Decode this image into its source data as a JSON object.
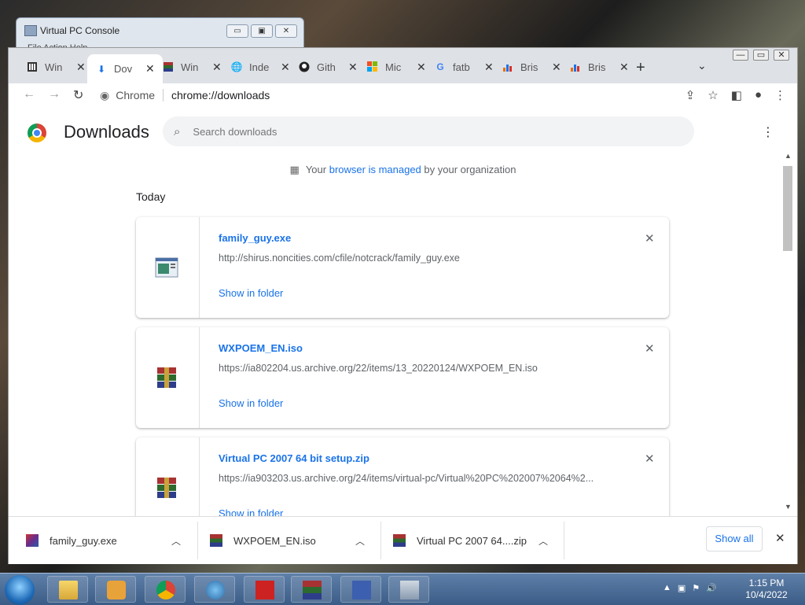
{
  "vpc_console": {
    "title": "Virtual PC Console",
    "menu": "File   Action   Help"
  },
  "browser": {
    "tabs": [
      {
        "label": "Win",
        "icon": "archive-icon"
      },
      {
        "label": "Dov",
        "icon": "download-icon",
        "active": true
      },
      {
        "label": "Win",
        "icon": "winrar-icon"
      },
      {
        "label": "Inde",
        "icon": "globe-icon"
      },
      {
        "label": "Gith",
        "icon": "github-icon"
      },
      {
        "label": "Mic",
        "icon": "microsoft-icon"
      },
      {
        "label": "fatb",
        "icon": "google-icon"
      },
      {
        "label": "Bris",
        "icon": "chart-icon"
      },
      {
        "label": "Bris",
        "icon": "chart-icon"
      }
    ],
    "omnibox": {
      "site_label": "Chrome",
      "url": "chrome://downloads"
    }
  },
  "downloads": {
    "title": "Downloads",
    "search_placeholder": "Search downloads",
    "managed": {
      "prefix": "Your",
      "link": "browser is managed",
      "suffix": "by your organization"
    },
    "section": "Today",
    "items": [
      {
        "name": "family_guy.exe",
        "url": "http://shirus.noncities.com/cfile/notcrack/family_guy.exe",
        "action": "Show in folder"
      },
      {
        "name": "WXPOEM_EN.iso",
        "url": "https://ia802204.us.archive.org/22/items/13_20220124/WXPOEM_EN.iso",
        "action": "Show in folder"
      },
      {
        "name": "Virtual PC 2007 64 bit setup.zip",
        "url": "https://ia903203.us.archive.org/24/items/virtual-pc/Virtual%20PC%202007%2064%2...",
        "action": "Show in folder"
      }
    ]
  },
  "shelf": {
    "items": [
      {
        "name": "family_guy.exe"
      },
      {
        "name": "WXPOEM_EN.iso"
      },
      {
        "name": "Virtual PC 2007 64....zip"
      }
    ],
    "show_all": "Show all"
  },
  "taskbar": {
    "time": "1:15 PM",
    "date": "10/4/2022"
  }
}
